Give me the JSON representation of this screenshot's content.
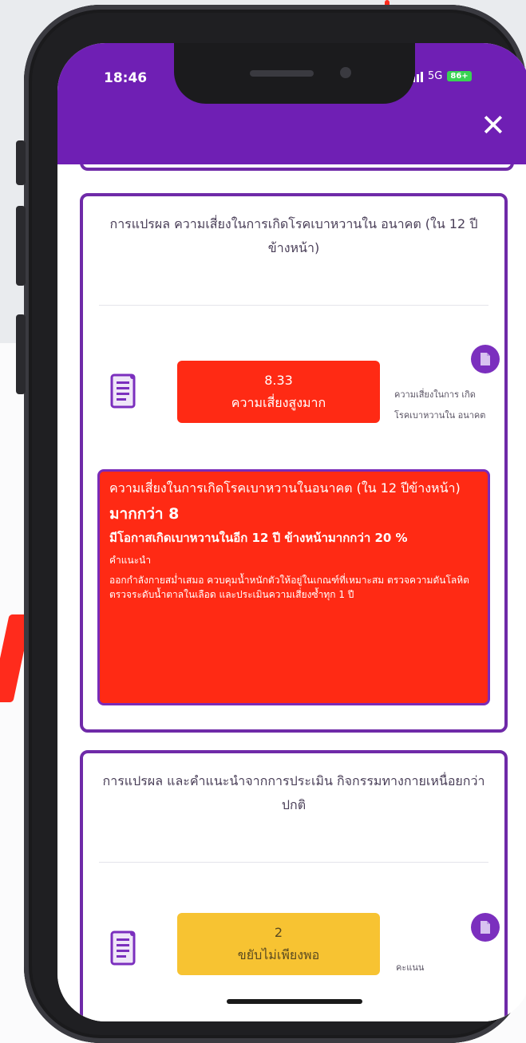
{
  "status_bar": {
    "time": "18:46",
    "network": "5G",
    "battery": "86+"
  },
  "header": {
    "close_label": "✕",
    "bg_color": "#6f1fb4"
  },
  "card1": {
    "title": "การแปรผล ความเสี่ยงในการเกิดโรคเบาหวานใน อนาคต (ใน 12 ปีข้างหน้า)",
    "score_value": "8.33",
    "score_label": "ความเสี่ยงสูงมาก",
    "score_color": "#ff2a14",
    "side_note": "ความเสี่ยงในการ เกิดโรคเบาหวานใน อนาคต",
    "alert": {
      "line1": "ความเสี่ยงในการเกิดโรคเบาหวานในอนาคต (ใน 12 ปีข้างหน้า)",
      "line2": "มากกว่า 8",
      "line3": "มีโอกาสเกิดเบาหวานในอีก 12 ปี ข้างหน้ามากกว่า 20 %",
      "line4": "คำแนะนำ",
      "line5": "ออกกำลังกายสม่ำเสมอ ควบคุมน้ำหนักตัวให้อยู่ในเกณฑ์ที่เหมาะสม ตรวจความดันโลหิต ตรวจระดับน้ำตาลในเลือด และประเมินความเสี่ยงซ้ำทุก 1 ปี"
    }
  },
  "card2": {
    "title": "การแปรผล และคำแนะนำจากการประเมิน กิจกรรมทางกายเหนื่อยกว่าปกติ",
    "score_value": "2",
    "score_label": "ขยับไม่เพียงพอ",
    "score_color": "#f7c332",
    "side_note": "คะแนน"
  }
}
